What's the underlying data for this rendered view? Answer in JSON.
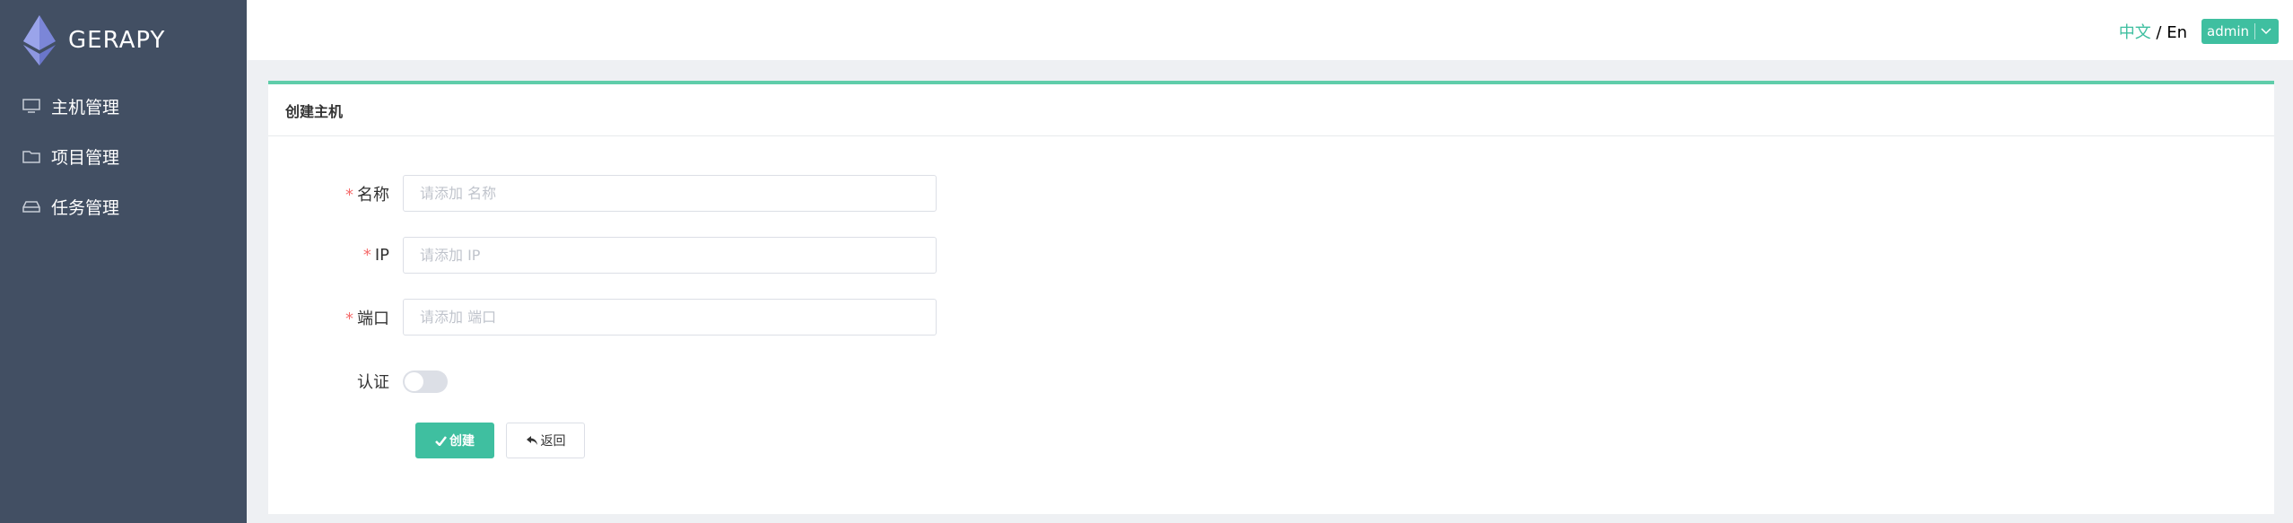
{
  "app": {
    "name": "GERAPY"
  },
  "sidebar": {
    "items": [
      {
        "label": "主机管理",
        "icon": "monitor-icon"
      },
      {
        "label": "项目管理",
        "icon": "folder-icon"
      },
      {
        "label": "任务管理",
        "icon": "inbox-icon"
      }
    ]
  },
  "header": {
    "lang_zh": "中文",
    "lang_sep": " / ",
    "lang_en": "En",
    "user": "admin"
  },
  "card": {
    "title": "创建主机"
  },
  "form": {
    "name": {
      "required_mark": "*",
      "label": "名称",
      "placeholder": "请添加 名称",
      "value": ""
    },
    "ip": {
      "required_mark": "*",
      "label": "IP",
      "placeholder": "请添加 IP",
      "value": ""
    },
    "port": {
      "required_mark": "*",
      "label": "端口",
      "placeholder": "请添加 端口",
      "value": ""
    },
    "auth": {
      "label": "认证",
      "enabled": false
    }
  },
  "buttons": {
    "create": "创建",
    "back": "返回"
  },
  "colors": {
    "sidebar_bg": "#424f63",
    "accent": "#3fbfa0",
    "required": "#f56c6c"
  }
}
